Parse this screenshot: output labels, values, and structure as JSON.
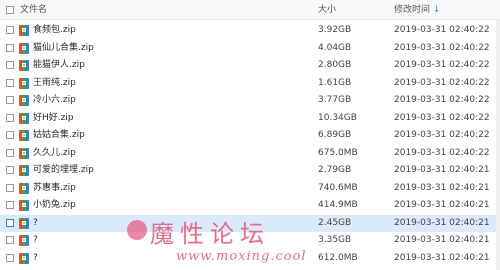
{
  "header": {
    "name": "文件名",
    "size": "大小",
    "date": "修改时间",
    "sort_indicator": "↓"
  },
  "files": [
    {
      "name": "食频包.zip",
      "size": "3.92GB",
      "date": "2019-03-31 02:40:22"
    },
    {
      "name": "猫仙儿合集.zip",
      "size": "4.04GB",
      "date": "2019-03-31 02:40:22"
    },
    {
      "name": "能猫伊人.zip",
      "size": "2.80GB",
      "date": "2019-03-31 02:40:22"
    },
    {
      "name": "王雨纯.zip",
      "size": "1.61GB",
      "date": "2019-03-31 02:40:22"
    },
    {
      "name": "冷小六.zip",
      "size": "3.77GB",
      "date": "2019-03-31 02:40:22"
    },
    {
      "name": "好H好.zip",
      "size": "10.34GB",
      "date": "2019-03-31 02:40:22"
    },
    {
      "name": "姑姑合集.zip",
      "size": "6.89GB",
      "date": "2019-03-31 02:40:22"
    },
    {
      "name": "久久儿.zip",
      "size": "675.0MB",
      "date": "2019-03-31 02:40:22"
    },
    {
      "name": "可爱的埋埋.zip",
      "size": "2.79GB",
      "date": "2019-03-31 02:40:21"
    },
    {
      "name": "苏惠事.zip",
      "size": "740.6MB",
      "date": "2019-03-31 02:40:21"
    },
    {
      "name": "小奶兔.zip",
      "size": "414.9MB",
      "date": "2019-03-31 02:40:21"
    },
    {
      "name": "?",
      "size": "2.45GB",
      "date": "2019-03-31 02:40:21"
    },
    {
      "name": "?",
      "size": "3.35GB",
      "date": "2019-03-31 02:40:21"
    },
    {
      "name": "?",
      "size": "612.0MB",
      "date": "2019-03-31 02:40:21"
    }
  ],
  "selected_row": 11,
  "watermark": {
    "title": "魔性论坛",
    "url": "www.moxing.cool"
  },
  "colors": {
    "selection": "#dbeafa",
    "watermark": "#e3557a"
  },
  "icons": {
    "file": "zip-archive-icon",
    "checkbox": "checkbox-icon"
  }
}
